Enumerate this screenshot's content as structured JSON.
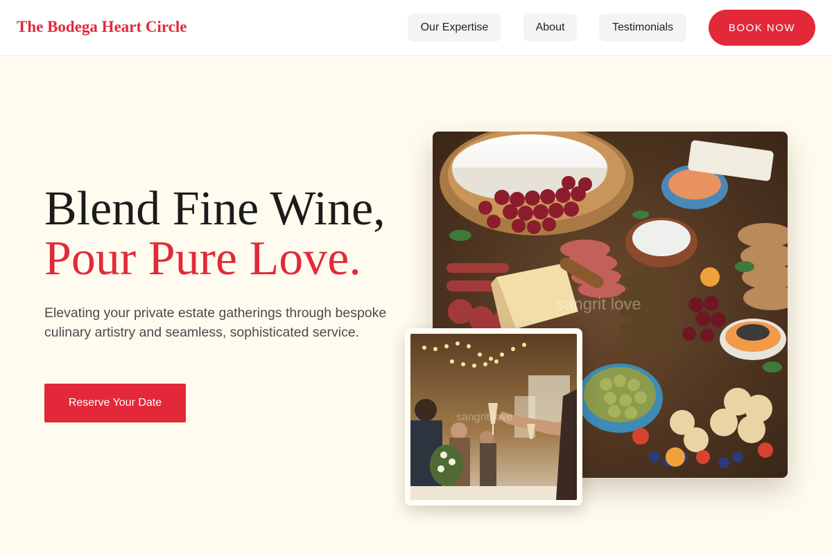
{
  "brand": {
    "name": "The Bodega Heart Circle"
  },
  "nav": {
    "items": [
      {
        "label": "Our Expertise"
      },
      {
        "label": "About"
      },
      {
        "label": "Testimonials"
      }
    ],
    "cta_label": "BOOK NOW"
  },
  "hero": {
    "headline_line1": "Blend Fine Wine,",
    "headline_line2": "Pour Pure Love.",
    "subtext": "Elevating your private estate gatherings through bespoke culinary artistry and seamless, sophisticated service.",
    "cta_label": "Reserve Your Date"
  },
  "images": {
    "main": {
      "watermark": "sangrit love",
      "alt": "charcuterie-board"
    },
    "secondary": {
      "watermark": "sangrit love",
      "alt": "toast-celebration"
    }
  },
  "colors": {
    "accent": "#e3283a",
    "background": "#fffbee",
    "header_bg": "#ffffff",
    "nav_pill_bg": "#f4f4f2"
  }
}
